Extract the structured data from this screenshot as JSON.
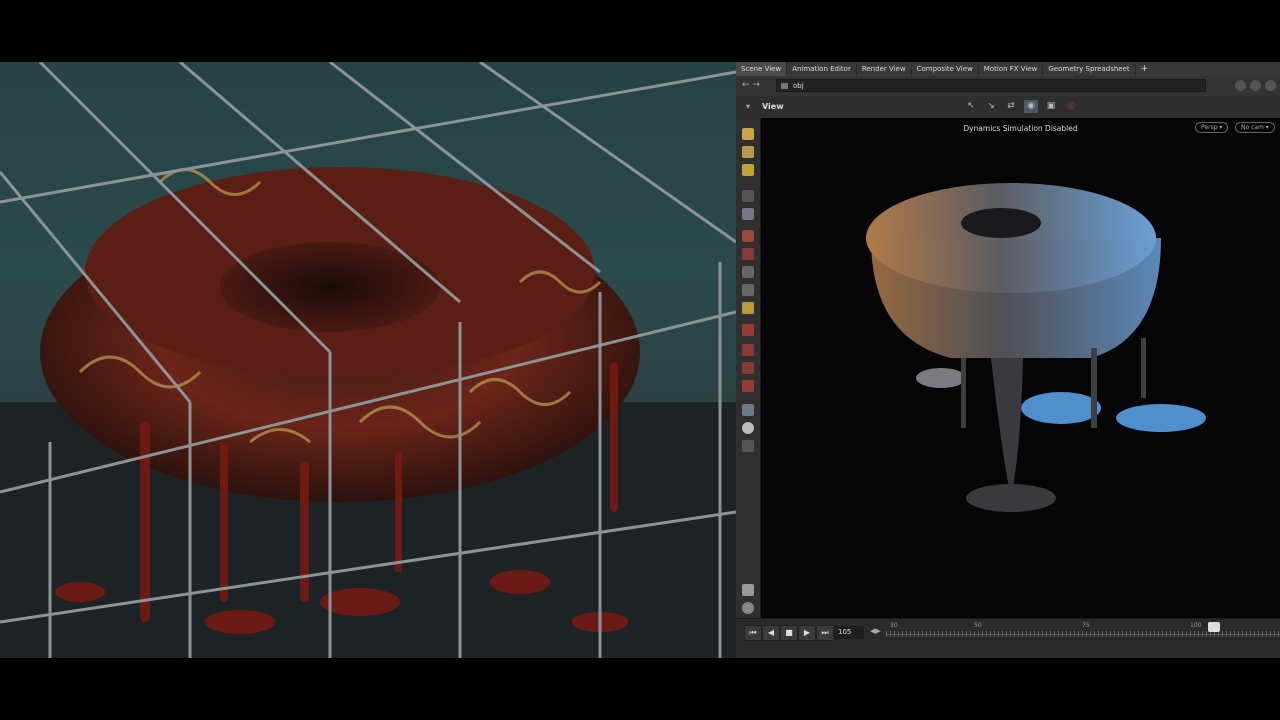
{
  "tabs": [
    {
      "label": "Scene View",
      "active": true
    },
    {
      "label": "Animation Editor",
      "active": false
    },
    {
      "label": "Render View",
      "active": false
    },
    {
      "label": "Composite View",
      "active": false
    },
    {
      "label": "Motion FX View",
      "active": false
    },
    {
      "label": "Geometry Spreadsheet",
      "active": false
    }
  ],
  "tab_add_icon": "+",
  "path": {
    "value": "obj"
  },
  "viewport": {
    "title": "View",
    "message": "Dynamics Simulation Disabled",
    "camera_label": "Persp ▾",
    "display_label": "No cam ▾"
  },
  "timeline": {
    "frame": "105",
    "ticks": [
      "30",
      "50",
      "75",
      "100"
    ],
    "buttons": [
      "⏮",
      "◀",
      "■",
      "▶",
      "⏭"
    ]
  },
  "colors": {
    "accent_selected": "#4d5a66",
    "viewport_bg": "#050506",
    "panel_bg": "#2b2b2b"
  }
}
